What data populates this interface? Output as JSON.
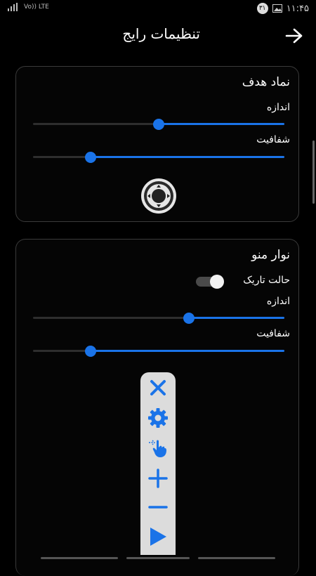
{
  "status_bar": {
    "volte_label": "Vo)) LTE",
    "time": "۱۱:۴۵",
    "notification_count": "۳۱"
  },
  "header": {
    "title": "تنظیمات رایج"
  },
  "target_card": {
    "title": "نماد هدف",
    "size_label": "اندازه",
    "size_value": 0.5,
    "opacity_label": "شفافیت",
    "opacity_value": 0.23
  },
  "menu_card": {
    "title": "نوار منو",
    "dark_mode_label": "حالت تاریک",
    "dark_mode_on": true,
    "size_label": "اندازه",
    "size_value": 0.62,
    "opacity_label": "شفافیت",
    "opacity_value": 0.23
  },
  "menu_bar_items": [
    "close-icon",
    "gear-icon",
    "tap-gesture-icon",
    "plus-icon",
    "minus-icon",
    "play-icon"
  ],
  "colors": {
    "accent": "#1a73e8",
    "background": "#000000",
    "card_border": "#3a3a3a",
    "menu_bar_bg": "#dcdcdc"
  }
}
